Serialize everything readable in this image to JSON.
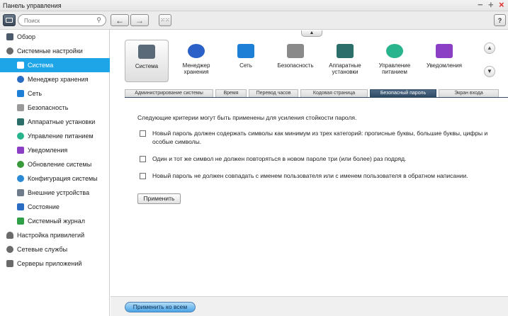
{
  "window": {
    "title": "Панель управления"
  },
  "toolbar": {
    "search_placeholder": "Поиск",
    "help_label": "?"
  },
  "sidebar": {
    "items": [
      {
        "label": "Обзор",
        "icon": "overview-icon",
        "color": "#4a5a6a"
      },
      {
        "label": "Системные настройки",
        "icon": "gear-icon",
        "color": "#6a6a6a"
      },
      {
        "label": "Система",
        "icon": "system-icon",
        "color": "#ffffff"
      },
      {
        "label": "Менеджер хранения",
        "icon": "storage-icon",
        "color": "#2a6cc4"
      },
      {
        "label": "Сеть",
        "icon": "network-icon",
        "color": "#1e7fd6"
      },
      {
        "label": "Безопасность",
        "icon": "lock-icon",
        "color": "#9a9a9a"
      },
      {
        "label": "Аппаратные установки",
        "icon": "hardware-icon",
        "color": "#2c6f6a"
      },
      {
        "label": "Управление питанием",
        "icon": "power-icon",
        "color": "#28b48c"
      },
      {
        "label": "Уведомления",
        "icon": "notification-icon",
        "color": "#8a3fc4"
      },
      {
        "label": "Обновление системы",
        "icon": "update-icon",
        "color": "#3a9a3a"
      },
      {
        "label": "Конфигурация системы",
        "icon": "config-icon",
        "color": "#2a8ad6"
      },
      {
        "label": "Внешние устройства",
        "icon": "external-device-icon",
        "color": "#6d7b8a"
      },
      {
        "label": "Состояние",
        "icon": "status-icon",
        "color": "#2a6cc4"
      },
      {
        "label": "Системный журнал",
        "icon": "log-icon",
        "color": "#2fa048"
      },
      {
        "label": "Настройка привилегий",
        "icon": "user-icon",
        "color": "#6a6a6a"
      },
      {
        "label": "Сетевые службы",
        "icon": "network-services-icon",
        "color": "#6a6a6a"
      },
      {
        "label": "Серверы приложений",
        "icon": "app-servers-icon",
        "color": "#6a6a6a"
      }
    ]
  },
  "categories": [
    {
      "label": "Система",
      "icon": "system-icon",
      "color": "#5a6a78"
    },
    {
      "label": "Менеджер хранения",
      "icon": "storage-icon",
      "color": "#2a60c8"
    },
    {
      "label": "Сеть",
      "icon": "network-icon",
      "color": "#1e7fd6"
    },
    {
      "label": "Безопасность",
      "icon": "lock-icon",
      "color": "#8a8a8a"
    },
    {
      "label": "Аппаратные установки",
      "icon": "hardware-icon",
      "color": "#2c6f6a"
    },
    {
      "label": "Управление питанием",
      "icon": "power-icon",
      "color": "#28b48c"
    },
    {
      "label": "Уведомления",
      "icon": "notification-icon",
      "color": "#8a3fc4"
    }
  ],
  "subtabs": [
    "Администрирование системы",
    "Время",
    "Перевод часов",
    "Кодовая страница",
    "Безопасный пароль",
    "Экран входа"
  ],
  "content": {
    "intro": "Следующие критерии могут быть применены для усиления стойкости пароля.",
    "options": [
      {
        "text": "Новый пароль должен содержать символы как минимум из трех категорий: прописные буквы, большие буквы, цифры и особые символы.",
        "checked": false
      },
      {
        "text": "Один и тот же символ не должен повторяться в новом пароле три (или более) раз подряд.",
        "checked": false
      },
      {
        "text": "Новый пароль не должен совпадать с именем пользователя или с именем пользователя в обратном написании.",
        "checked": false
      }
    ],
    "apply_label": "Применить"
  },
  "footer": {
    "apply_all_label": "Применить ко всем"
  },
  "colors": {
    "accent": "#1ea5e8",
    "active_tab": "#2f4a63",
    "close": "#e03030"
  }
}
